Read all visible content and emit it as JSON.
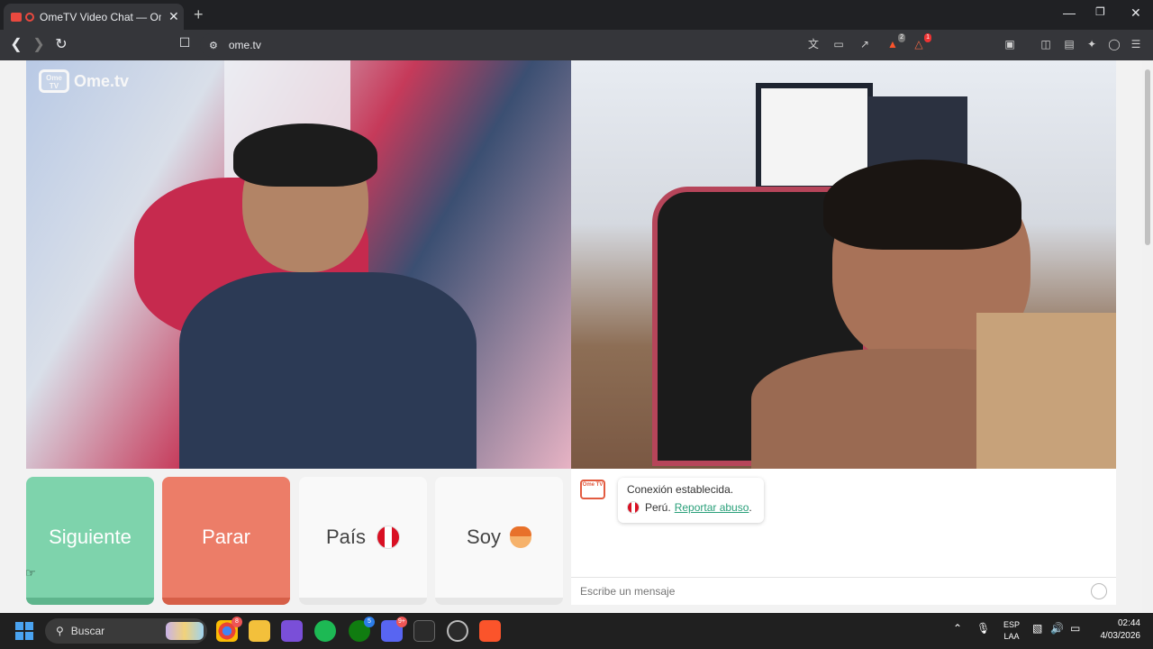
{
  "browser": {
    "tab_title": "OmeTV Video Chat — Omegle",
    "tab_close": "✕",
    "new_tab": "+",
    "url": "ome.tv",
    "extension_badges": {
      "brave": "2",
      "rewards": "1"
    }
  },
  "page": {
    "logo_icon_text": "Ome TV",
    "logo_text": "Ome.tv",
    "buttons": {
      "next": "Siguiente",
      "stop": "Parar",
      "country": "País",
      "gender": "Soy"
    },
    "chat": {
      "logo_icon_text": "Ome TV",
      "status": "Conexión establecida.",
      "country": "Perú.",
      "report_link": "Reportar abuso",
      "report_suffix": ".",
      "input_placeholder": "Escribe un mensaje"
    }
  },
  "taskbar": {
    "search_label": "Buscar",
    "badges": {
      "chrome": "8",
      "xbox": "5",
      "discord": "9+"
    },
    "lang_line1": "ESP",
    "lang_line2": "LAA",
    "time": "02:44",
    "date": "4/03/2026"
  },
  "colors": {
    "next": "#7ed3ac",
    "stop": "#ec7d68",
    "link": "#2aa07a"
  }
}
